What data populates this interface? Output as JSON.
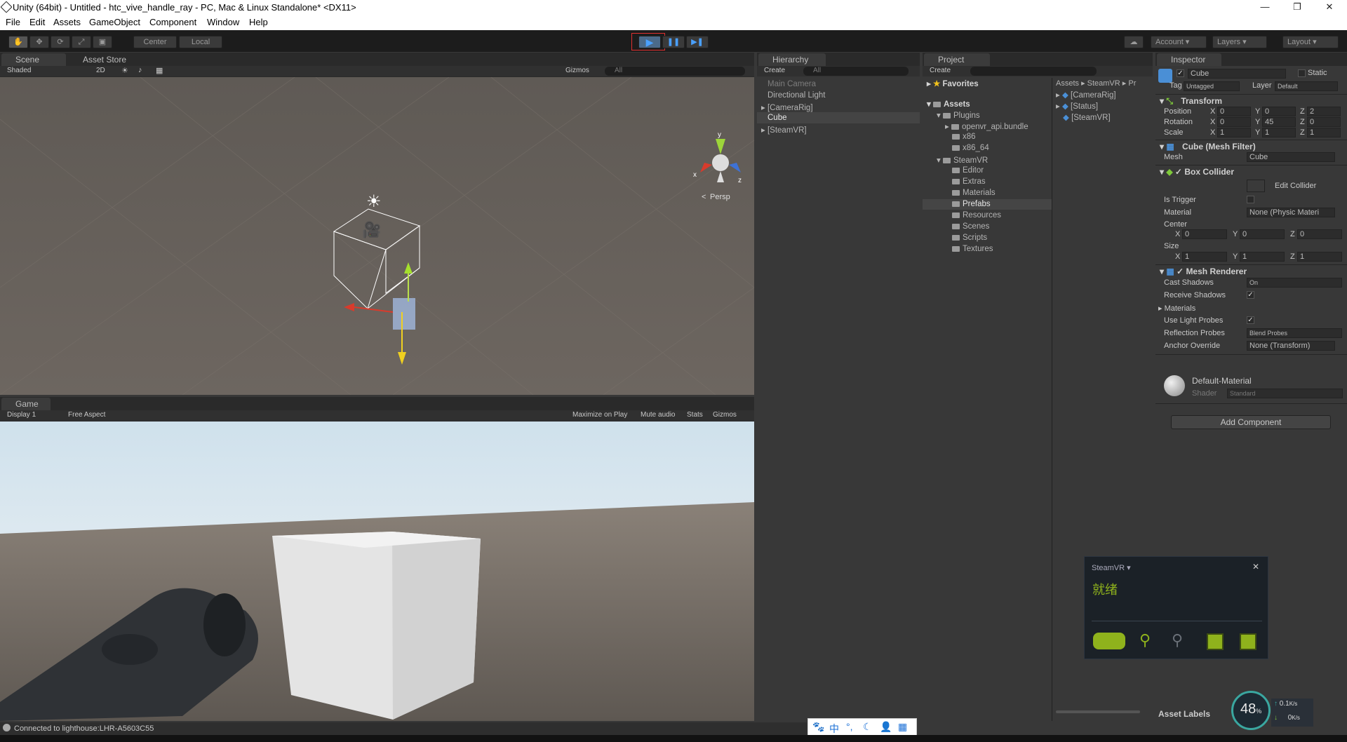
{
  "window": {
    "title": "Unity (64bit) - Untitled - htc_vive_handle_ray - PC, Mac & Linux Standalone* <DX11>",
    "minimize": "—",
    "restore": "❐",
    "close": "✕"
  },
  "menu": [
    "File",
    "Edit",
    "Assets",
    "GameObject",
    "Component",
    "Window",
    "Help"
  ],
  "toolbar": {
    "pivot": "Center",
    "space": "Local",
    "account": "Account",
    "layers": "Layers",
    "layout": "Layout"
  },
  "scene": {
    "tab": "Scene",
    "tab2": "Asset Store",
    "shading": "Shaded",
    "mode2d": "2D",
    "gizmos": "Gizmos",
    "search": "All",
    "persp": "Persp",
    "axis_x": "x",
    "axis_y": "y",
    "axis_z": "z"
  },
  "game": {
    "tab": "Game",
    "display": "Display 1",
    "aspect": "Free Aspect",
    "maximize": "Maximize on Play",
    "mute": "Mute audio",
    "stats": "Stats",
    "gizmos": "Gizmos"
  },
  "hierarchy": {
    "tab": "Hierarchy",
    "create": "Create",
    "search": "All",
    "items": [
      "Main Camera",
      "Directional Light",
      "[CameraRig]",
      "Cube",
      "[SteamVR]"
    ]
  },
  "project": {
    "tab": "Project",
    "create": "Create",
    "favorites": "Favorites",
    "assets": "Assets",
    "tree": [
      "Plugins",
      "openvr_api.bundle",
      "x86",
      "x86_64",
      "SteamVR",
      "Editor",
      "Extras",
      "Materials",
      "Prefabs",
      "Resources",
      "Scenes",
      "Scripts",
      "Textures"
    ],
    "breadcrumb": "Assets ▸ SteamVR ▸ Pr",
    "files": [
      "[CameraRig]",
      "[Status]",
      "[SteamVR]"
    ]
  },
  "inspector": {
    "tab": "Inspector",
    "object": "Cube",
    "static": "Static",
    "tag_label": "Tag",
    "tag": "Untagged",
    "layer_label": "Layer",
    "layer": "Default",
    "transform": {
      "title": "Transform",
      "position_label": "Position",
      "rotation_label": "Rotation",
      "scale_label": "Scale",
      "px": "0",
      "py": "0",
      "pz": "2",
      "rx": "0",
      "ry": "45",
      "rz": "0",
      "sx": "1",
      "sy": "1",
      "sz": "1"
    },
    "meshfilter": {
      "title": "Cube (Mesh Filter)",
      "mesh_label": "Mesh",
      "mesh": "Cube"
    },
    "collider": {
      "title": "Box Collider",
      "edit": "Edit Collider",
      "trigger": "Is Trigger",
      "material_label": "Material",
      "material": "None (Physic Materi",
      "center": "Center",
      "size": "Size",
      "cx": "0",
      "cy": "0",
      "cz": "0",
      "sx": "1",
      "sy": "1",
      "sz": "1"
    },
    "renderer": {
      "title": "Mesh Renderer",
      "cast": "Cast Shadows",
      "cast_val": "On",
      "receive": "Receive Shadows",
      "materials": "Materials",
      "probes": "Use Light Probes",
      "reflection": "Reflection Probes",
      "reflection_val": "Blend Probes",
      "anchor": "Anchor Override",
      "anchor_val": "None (Transform)"
    },
    "material": {
      "name": "Default-Material",
      "shader_label": "Shader",
      "shader": "Standard"
    },
    "add": "Add Component",
    "labels": "Asset Labels"
  },
  "steamvr": {
    "title": "SteamVR ▾",
    "status": "就绪",
    "close": "✕"
  },
  "statusbar": {
    "message": "Connected to lighthouse:LHR-A5603C55"
  },
  "netmon": {
    "percent": "48",
    "unit": "%",
    "up": "0.1",
    "up_unit": "K/s",
    "down": "0",
    "down_unit": "K/s"
  },
  "colors": {
    "accent": "#3d6dbf",
    "steam_green": "#8fb21c",
    "dark": "#1c1c1c"
  }
}
